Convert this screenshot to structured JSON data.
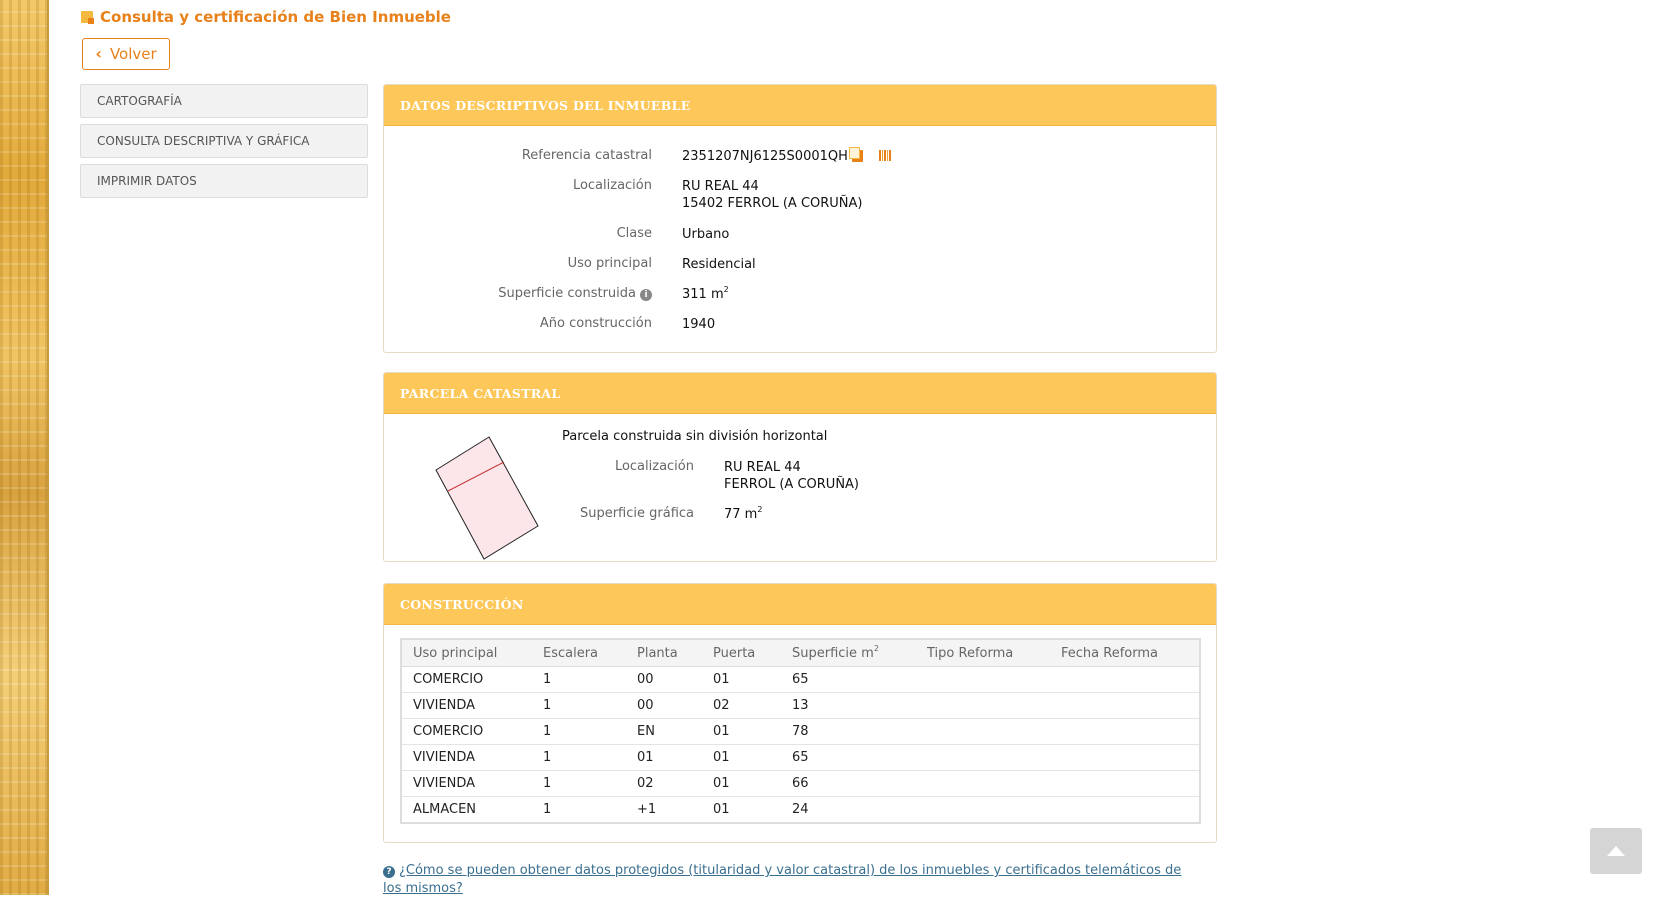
{
  "page": {
    "title": "Consulta y certificación de Bien Inmueble"
  },
  "back_button": {
    "label": "Volver"
  },
  "menu": {
    "items": [
      {
        "label": "CARTOGRAFÍA"
      },
      {
        "label": "CONSULTA DESCRIPTIVA Y GRÁFICA"
      },
      {
        "label": "IMPRIMIR DATOS"
      }
    ]
  },
  "datos": {
    "header": "DATOS DESCRIPTIVOS DEL INMUEBLE",
    "referencia_label": "Referencia catastral",
    "referencia_value": "2351207NJ6125S0001QH",
    "localizacion_label": "Localización",
    "localizacion_line1": "RU REAL 44",
    "localizacion_line2": "15402 FERROL (A CORUÑA)",
    "clase_label": "Clase",
    "clase_value": "Urbano",
    "uso_label": "Uso principal",
    "uso_value": "Residencial",
    "superficie_label": "Superficie construida",
    "superficie_value": "311 m",
    "superficie_sup": "2",
    "anio_label": "Año construcción",
    "anio_value": "1940"
  },
  "parcela": {
    "header": "PARCELA CATASTRAL",
    "subtitle": "Parcela construida sin división horizontal",
    "localizacion_label": "Localización",
    "localizacion_line1": "RU REAL 44",
    "localizacion_line2": "FERROL (A CORUÑA)",
    "superficie_label": "Superficie gráfica",
    "superficie_value": "77 m",
    "superficie_sup": "2"
  },
  "construccion": {
    "header": "CONSTRUCCIÓN",
    "columns": [
      "Uso principal",
      "Escalera",
      "Planta",
      "Puerta",
      "Superficie m",
      "Tipo Reforma",
      "Fecha Reforma"
    ],
    "superficie_sup": "2",
    "rows": [
      [
        "COMERCIO",
        "1",
        "00",
        "01",
        "65",
        "",
        ""
      ],
      [
        "VIVIENDA",
        "1",
        "00",
        "02",
        "13",
        "",
        ""
      ],
      [
        "COMERCIO",
        "1",
        "EN",
        "01",
        "78",
        "",
        ""
      ],
      [
        "VIVIENDA",
        "1",
        "01",
        "01",
        "65",
        "",
        ""
      ],
      [
        "VIVIENDA",
        "1",
        "02",
        "01",
        "66",
        "",
        ""
      ],
      [
        "ALMACEN",
        "1",
        "+1",
        "01",
        "24",
        "",
        ""
      ]
    ]
  },
  "help_link": "¿Cómo se pueden obtener datos protegidos (titularidad y valor catastral) de los inmuebles y certificados telemáticos de los mismos?",
  "colors": {
    "accent": "#e8811a",
    "header_bg": "#fdc75a",
    "link": "#3a6f8f"
  }
}
